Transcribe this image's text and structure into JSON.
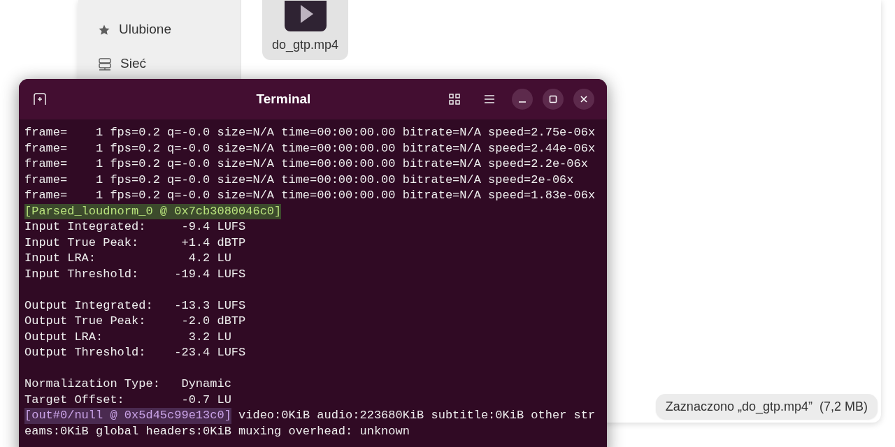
{
  "file_manager": {
    "sidebar": {
      "items": [
        {
          "label": "Ulubione",
          "kind": "star",
          "selected": false
        },
        {
          "label": "Sieć",
          "kind": "network",
          "selected": false
        }
      ]
    },
    "files": [
      {
        "name": "do_gtp.mp4",
        "selected": true
      }
    ],
    "status": "Zaznaczono „do_gtp.mp4”  (7,2 MB)"
  },
  "terminal": {
    "title": "Terminal",
    "lines": [
      {
        "kind": "text",
        "text": "frame=    1 fps=0.2 q=-0.0 size=N/A time=00:00:00.00 bitrate=N/A speed=2.75e-06x"
      },
      {
        "kind": "text",
        "text": "frame=    1 fps=0.2 q=-0.0 size=N/A time=00:00:00.00 bitrate=N/A speed=2.44e-06x"
      },
      {
        "kind": "text",
        "text": "frame=    1 fps=0.2 q=-0.0 size=N/A time=00:00:00.00 bitrate=N/A speed=2.2e-06x"
      },
      {
        "kind": "text",
        "text": "frame=    1 fps=0.2 q=-0.0 size=N/A time=00:00:00.00 bitrate=N/A speed=2e-06x"
      },
      {
        "kind": "text",
        "text": "frame=    1 fps=0.2 q=-0.0 size=N/A time=00:00:00.00 bitrate=N/A speed=1.83e-06x"
      },
      {
        "kind": "filter_tag",
        "tag": "[Parsed_loudnorm_0 @ 0x7cb3080046c0]"
      },
      {
        "kind": "text",
        "text": "Input Integrated:     -9.4 LUFS"
      },
      {
        "kind": "text",
        "text": "Input True Peak:      +1.4 dBTP"
      },
      {
        "kind": "text",
        "text": "Input LRA:             4.2 LU"
      },
      {
        "kind": "text",
        "text": "Input Threshold:     -19.4 LUFS"
      },
      {
        "kind": "blank"
      },
      {
        "kind": "text",
        "text": "Output Integrated:   -13.3 LUFS"
      },
      {
        "kind": "text",
        "text": "Output True Peak:     -2.0 dBTP"
      },
      {
        "kind": "text",
        "text": "Output LRA:            3.2 LU"
      },
      {
        "kind": "text",
        "text": "Output Threshold:    -23.4 LUFS"
      },
      {
        "kind": "blank"
      },
      {
        "kind": "text",
        "text": "Normalization Type:   Dynamic"
      },
      {
        "kind": "text",
        "text": "Target Offset:        -0.7 LU"
      },
      {
        "kind": "output_tag",
        "tag": "[out#0/null @ 0x5d45c99e13c0]",
        "text": " video:0KiB audio:223680KiB subtitle:0KiB other str"
      },
      {
        "kind": "text",
        "text": "eams:0KiB global headers:0KiB muxing overhead: unknown"
      }
    ]
  }
}
